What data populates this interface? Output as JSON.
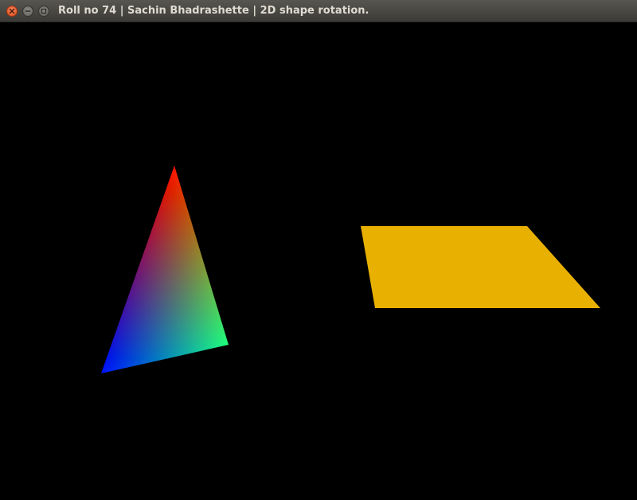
{
  "window": {
    "title": "Roll no 74 | Sachin Bhadrashette | 2D shape rotation.",
    "controls": {
      "close_icon": "close-icon",
      "minimize_icon": "minimize-icon",
      "maximize_icon": "maximize-icon"
    }
  },
  "scene": {
    "background_color": "#000000",
    "shapes": [
      {
        "name": "triangle",
        "fill": "vertex-color gradient",
        "vertex_colors": [
          "#ff0000",
          "#00ff00",
          "#0000ff"
        ]
      },
      {
        "name": "quadrilateral",
        "fill_color": "#e8b000"
      }
    ]
  }
}
